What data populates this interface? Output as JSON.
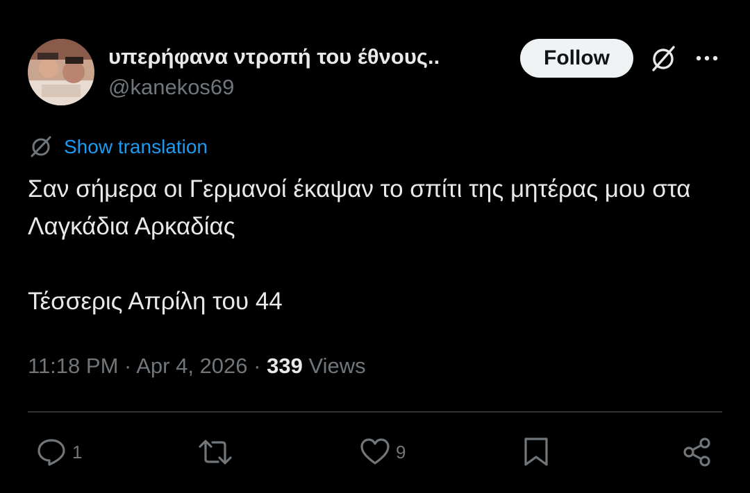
{
  "author": {
    "display_name": "υπερήφανα ντροπή του έθνους..",
    "handle": "@kanekos69"
  },
  "header": {
    "follow_label": "Follow",
    "icons": [
      "grok-icon",
      "more-icon"
    ]
  },
  "translation": {
    "label": "Show translation",
    "icon": "translate-icon"
  },
  "post": {
    "text": "Σαν σήμερα οι Γερμανοί έκαψαν το σπίτι της μητέρας μου στα Λαγκάδια Αρκαδίας\n\nΤέσσερις Απρίλη του 44"
  },
  "meta": {
    "time": "11:18 PM",
    "date": "Apr 4, 2026",
    "views_count": "339",
    "views_label": "Views"
  },
  "actions": {
    "reply_count": "1",
    "repost_count": "",
    "like_count": "9"
  },
  "colors": {
    "background": "#000000",
    "text": "#e7e9ea",
    "secondary": "#71767b",
    "link": "#1d9bf0",
    "divider": "#2f3336",
    "follow_button": "#eff3f4"
  }
}
